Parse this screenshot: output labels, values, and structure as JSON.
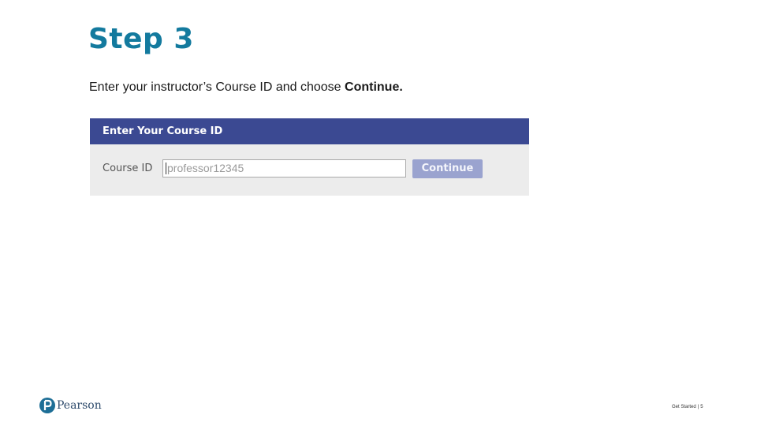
{
  "slide": {
    "title": "Step 3",
    "instruction_prefix": "Enter your instructor’s Course ID and choose ",
    "instruction_action": "Continue."
  },
  "course_panel": {
    "header": "Enter Your Course ID",
    "field_label": "Course ID",
    "input_placeholder": "professor12345",
    "input_value": "",
    "button_label": "Continue",
    "colors": {
      "header_bg": "#3b4992",
      "panel_bg": "#ececec",
      "button_bg": "#9aa3cf"
    }
  },
  "footer": {
    "brand": "Pearson",
    "section": "Get Started",
    "separator": "|",
    "page_number": "5"
  },
  "colors": {
    "title": "#137a9e",
    "brand": "#2d4a6b"
  },
  "icons": {
    "logo": "pearson-logo-icon"
  }
}
